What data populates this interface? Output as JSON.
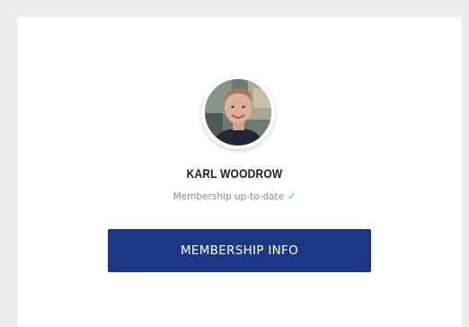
{
  "profile": {
    "name": "KARL WOODROW",
    "status_text": "Membership up-to-date",
    "status_icon": "check-icon",
    "avatar_icon": "user-avatar"
  },
  "actions": {
    "membership_button_label": "MEMBERSHIP INFO"
  },
  "colors": {
    "background": "#ececec",
    "card": "#ffffff",
    "button": "#1c3884",
    "check": "#2cb7a8",
    "status_text": "#8c8c8c"
  }
}
